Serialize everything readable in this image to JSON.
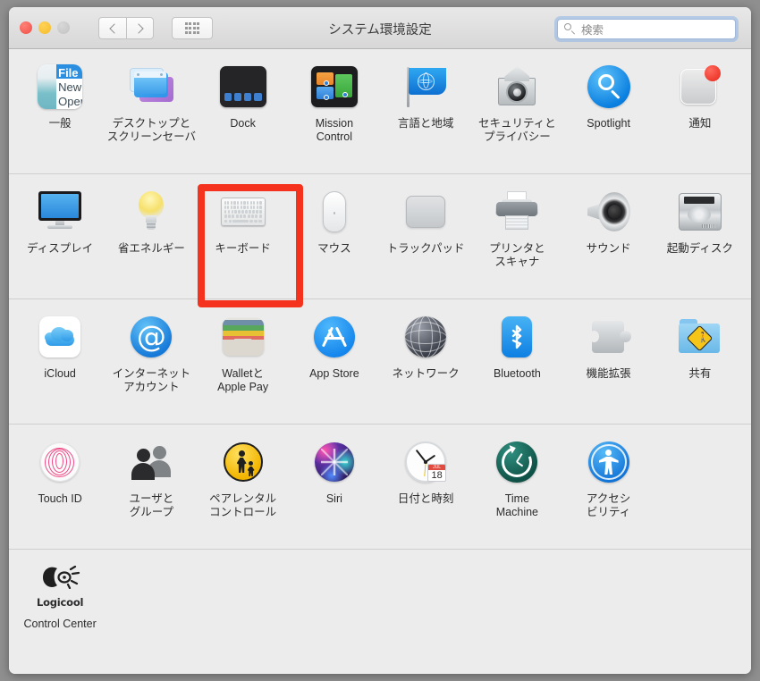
{
  "window": {
    "title": "システム環境設定",
    "traffic_lights": [
      "close",
      "minimize",
      "zoom"
    ],
    "nav": {
      "back_label": "‹",
      "forward_label": "›",
      "grid_label": "すべてを表示"
    },
    "search": {
      "value": "",
      "placeholder": "検索"
    }
  },
  "highlight": {
    "target": "キーボード",
    "color": "#f5321e"
  },
  "sections": [
    {
      "name": "personal",
      "items": [
        {
          "label": "一般",
          "icon": "general-icon",
          "art": {
            "menu_items": [
              "File",
              "New",
              "Open"
            ]
          }
        },
        {
          "label": "デスクトップと\nスクリーンセーバ",
          "icon": "desktop-screensaver-icon"
        },
        {
          "label": "Dock",
          "icon": "dock-icon"
        },
        {
          "label": "Mission\nControl",
          "icon": "mission-control-icon"
        },
        {
          "label": "言語と地域",
          "icon": "language-region-icon"
        },
        {
          "label": "セキュリティと\nプライバシー",
          "icon": "security-privacy-icon"
        },
        {
          "label": "Spotlight",
          "icon": "spotlight-icon"
        },
        {
          "label": "通知",
          "icon": "notifications-icon",
          "badge": true
        }
      ]
    },
    {
      "name": "hardware",
      "items": [
        {
          "label": "ディスプレイ",
          "icon": "display-icon"
        },
        {
          "label": "省エネルギー",
          "icon": "energy-saver-icon"
        },
        {
          "label": "キーボード",
          "icon": "keyboard-icon",
          "highlighted": true
        },
        {
          "label": "マウス",
          "icon": "mouse-icon"
        },
        {
          "label": "トラックパッド",
          "icon": "trackpad-icon"
        },
        {
          "label": "プリンタと\nスキャナ",
          "icon": "printers-scanners-icon"
        },
        {
          "label": "サウンド",
          "icon": "sound-icon"
        },
        {
          "label": "起動ディスク",
          "icon": "startup-disk-icon"
        }
      ]
    },
    {
      "name": "internet-wireless",
      "items": [
        {
          "label": "iCloud",
          "icon": "icloud-icon"
        },
        {
          "label": "インターネット\nアカウント",
          "icon": "internet-accounts-icon"
        },
        {
          "label": "Walletと\nApple Pay",
          "icon": "wallet-apple-pay-icon"
        },
        {
          "label": "App Store",
          "icon": "app-store-icon"
        },
        {
          "label": "ネットワーク",
          "icon": "network-icon"
        },
        {
          "label": "Bluetooth",
          "icon": "bluetooth-icon"
        },
        {
          "label": "機能拡張",
          "icon": "extensions-icon"
        },
        {
          "label": "共有",
          "icon": "sharing-icon"
        }
      ]
    },
    {
      "name": "system",
      "items": [
        {
          "label": "Touch ID",
          "icon": "touch-id-icon"
        },
        {
          "label": "ユーザと\nグループ",
          "icon": "users-groups-icon"
        },
        {
          "label": "ペアレンタル\nコントロール",
          "icon": "parental-controls-icon"
        },
        {
          "label": "Siri",
          "icon": "siri-icon"
        },
        {
          "label": "日付と時刻",
          "icon": "date-time-icon",
          "art": {
            "cal_month": "JUL",
            "cal_day": "18"
          }
        },
        {
          "label": "Time\nMachine",
          "icon": "time-machine-icon"
        },
        {
          "label": "アクセシ\nビリティ",
          "icon": "accessibility-icon"
        },
        {
          "label": "",
          "icon": ""
        }
      ]
    },
    {
      "name": "third-party",
      "items": [
        {
          "label": "Control Center",
          "icon": "logicool-control-center-icon",
          "art": {
            "brand": "Logicool"
          }
        },
        {
          "label": "",
          "icon": ""
        },
        {
          "label": "",
          "icon": ""
        },
        {
          "label": "",
          "icon": ""
        },
        {
          "label": "",
          "icon": ""
        },
        {
          "label": "",
          "icon": ""
        },
        {
          "label": "",
          "icon": ""
        },
        {
          "label": "",
          "icon": ""
        }
      ]
    }
  ]
}
